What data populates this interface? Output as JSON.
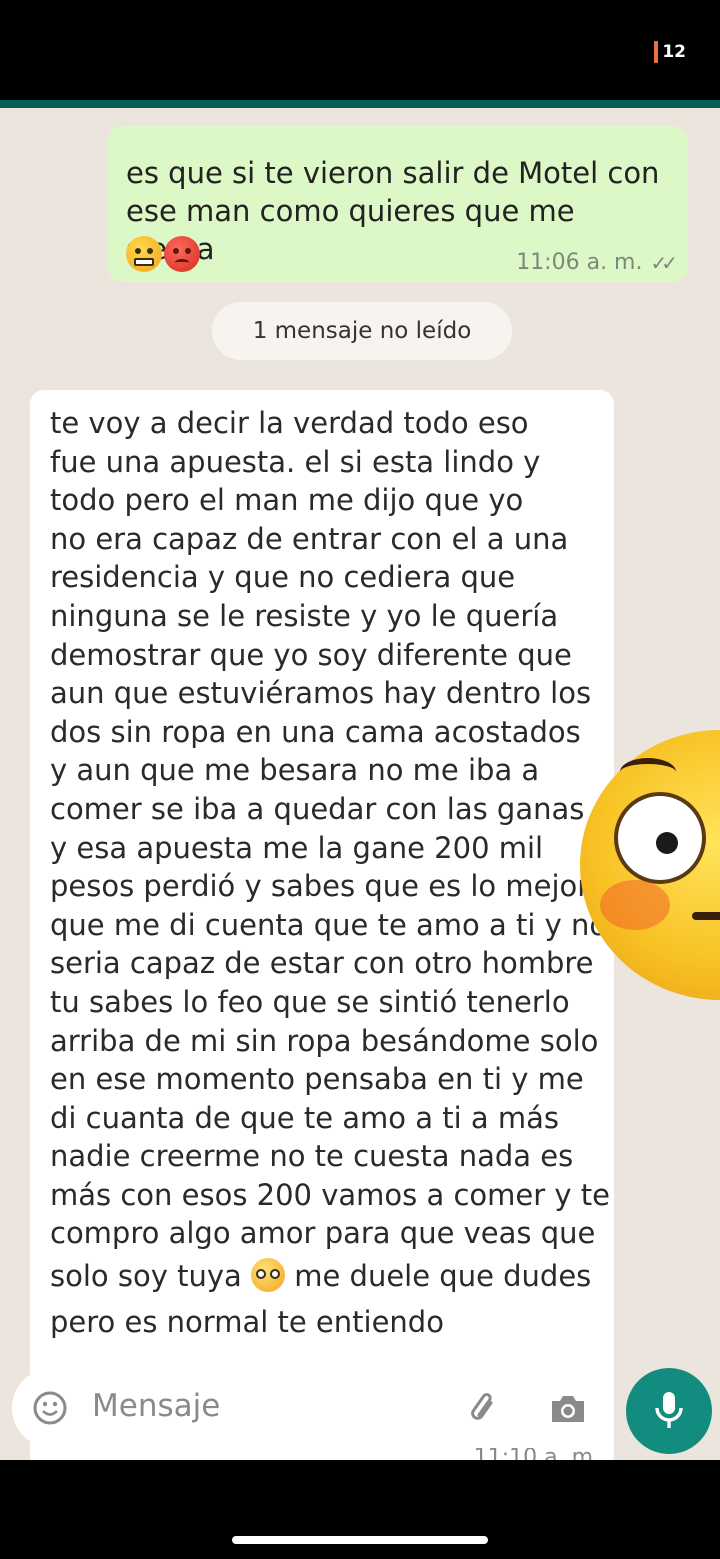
{
  "status_bar": {
    "battery_text": "12"
  },
  "outgoing_message": {
    "lines": [
      "es que si te vieron salir de Motel con",
      "ese man como quieres que me sienta"
    ],
    "emojis": [
      "grimacing-face",
      "angry-face"
    ],
    "time": "11:06 a. m.",
    "status_icon": "double-check-icon"
  },
  "unread_banner": "1 mensaje no leído",
  "incoming_message": {
    "lines": [
      "te voy a decir la verdad todo eso",
      "fue una apuesta.  el si esta lindo y",
      "todo pero el man me dijo  que yo",
      "no era capaz de entrar con el a una",
      "residencia y que no cediera que",
      "ninguna se le resiste y yo le quería",
      "demostrar que yo soy diferente que",
      "aun que estuviéramos hay dentro los",
      "dos sin ropa en una cama acostados",
      "y aun que me besara no me iba a",
      "comer se iba a quedar con las ganas",
      "y esa apuesta me la gane 200 mil",
      "pesos perdió y sabes que es lo mejor",
      "que me di cuenta que te amo a ti y no",
      "seria capaz de estar con otro hombre",
      "tu sabes lo feo que se sintió tenerlo",
      "arriba de mi sin ropa besándome solo",
      "en ese momento pensaba en ti y me",
      "di cuanta de que te amo a ti a más",
      "nadie creerme no te cuesta nada es",
      "más con esos 200 vamos a comer y te",
      "compro algo amor para que veas que"
    ],
    "line_before_emoji": "solo soy tuya",
    "inline_emoji": "pleading-face",
    "line_after_emoji": "me duele que dudes",
    "last_line": "pero es normal te entiendo",
    "time": "11:10 a. m."
  },
  "overlay_emoji": "flushed-face",
  "composer": {
    "placeholder": "Mensaje"
  },
  "colors": {
    "header": "#075e54",
    "outgoing_bubble": "#dcf8c6",
    "incoming_bubble": "#ffffff",
    "chat_bg": "#ece5dd",
    "mic_button": "#128c7e"
  }
}
